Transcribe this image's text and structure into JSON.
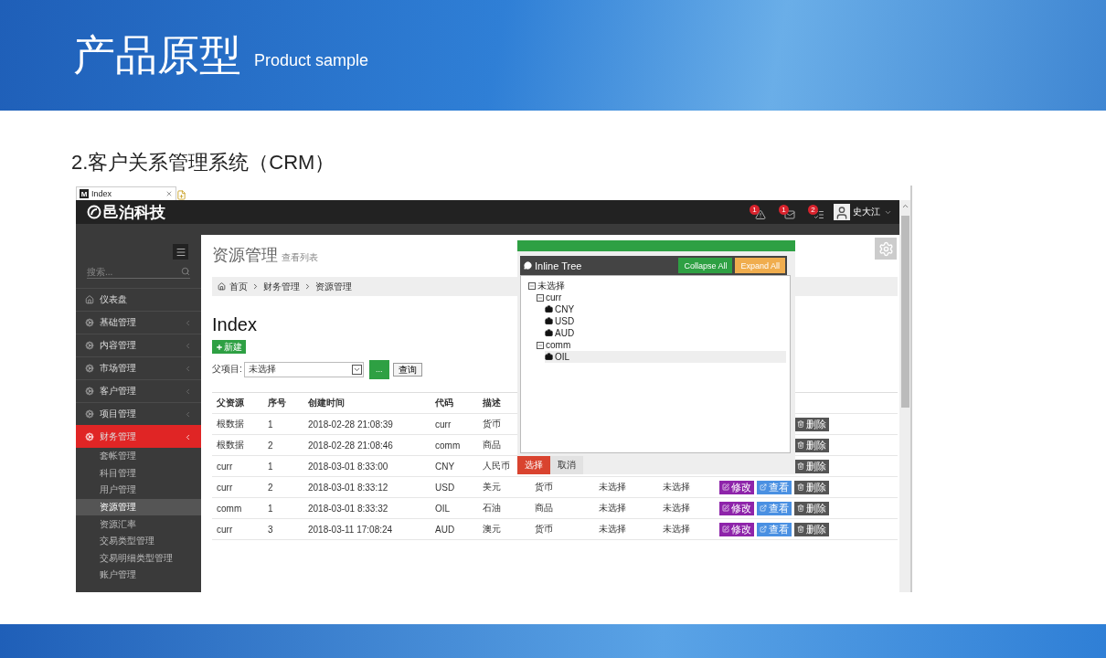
{
  "slide": {
    "title": "产品原型",
    "subtitle": "Product sample",
    "heading": "2.客户关系管理系统（CRM）"
  },
  "browser": {
    "tab": {
      "favicon": "M",
      "title": "Index"
    }
  },
  "topbar": {
    "logo": "邑泊科技",
    "alerts": [
      {
        "kind": "warning",
        "count": "1"
      },
      {
        "kind": "mail",
        "count": "1"
      },
      {
        "kind": "tasks",
        "count": "2"
      }
    ],
    "user": "史大江"
  },
  "sidebar": {
    "search": {
      "placeholder": "搜索..."
    },
    "items": [
      {
        "label": "仪表盘",
        "kind": "home",
        "selected": false
      },
      {
        "label": "基础管理",
        "kind": "group",
        "selected": false
      },
      {
        "label": "内容管理",
        "kind": "group",
        "selected": false
      },
      {
        "label": "市场管理",
        "kind": "group",
        "selected": false
      },
      {
        "label": "客户管理",
        "kind": "group",
        "selected": false
      },
      {
        "label": "项目管理",
        "kind": "group",
        "selected": false
      },
      {
        "label": "财务管理",
        "kind": "group",
        "selected": true,
        "children": [
          {
            "label": "套帐管理",
            "selected": false
          },
          {
            "label": "科目管理",
            "selected": false
          },
          {
            "label": "用户管理",
            "selected": false
          },
          {
            "label": "资源管理",
            "selected": true
          },
          {
            "label": "资源汇率",
            "selected": false
          },
          {
            "label": "交易类型管理",
            "selected": false
          },
          {
            "label": "交易明细类型管理",
            "selected": false
          },
          {
            "label": "账户管理",
            "selected": false
          }
        ]
      }
    ]
  },
  "page": {
    "title": "资源管理",
    "subtitle": "查看列表",
    "breadcrumb": [
      "首页",
      "财务管理",
      "资源管理"
    ],
    "heading": "Index",
    "new_button": "新建",
    "filter": {
      "label": "父项目:",
      "value": "未选择",
      "pick_button": "...",
      "query_button": "查询"
    }
  },
  "table": {
    "columns": [
      "父资源",
      "序号",
      "创建时间",
      "代码",
      "描述"
    ],
    "rows": [
      {
        "cells": [
          "根数据",
          "1",
          "2018-02-28 21:08:39",
          "curr",
          "货币"
        ],
        "actions": [
          {
            "kind": "delete",
            "label": "删除"
          }
        ]
      },
      {
        "cells": [
          "根数据",
          "2",
          "2018-02-28 21:08:46",
          "comm",
          "商品"
        ],
        "actions": [
          {
            "kind": "delete",
            "label": "删除"
          }
        ]
      },
      {
        "cells": [
          "curr",
          "1",
          "2018-03-01 8:33:00",
          "CNY",
          "人民币"
        ],
        "actions": [
          {
            "kind": "delete",
            "label": "删除"
          }
        ]
      },
      {
        "cells": [
          "curr",
          "2",
          "2018-03-01 8:33:12",
          "USD",
          "美元",
          "货币",
          "未选择",
          "未选择"
        ],
        "actions": [
          {
            "kind": "edit",
            "label": "修改"
          },
          {
            "kind": "view",
            "label": "查看"
          },
          {
            "kind": "delete",
            "label": "删除"
          }
        ]
      },
      {
        "cells": [
          "comm",
          "1",
          "2018-03-01 8:33:32",
          "OIL",
          "石油",
          "商品",
          "未选择",
          "未选择"
        ],
        "actions": [
          {
            "kind": "edit",
            "label": "修改"
          },
          {
            "kind": "view",
            "label": "查看"
          },
          {
            "kind": "delete",
            "label": "删除"
          }
        ]
      },
      {
        "cells": [
          "curr",
          "3",
          "2018-03-11 17:08:24",
          "AUD",
          "澳元",
          "货币",
          "未选择",
          "未选择"
        ],
        "actions": [
          {
            "kind": "edit",
            "label": "修改"
          },
          {
            "kind": "view",
            "label": "查看"
          },
          {
            "kind": "delete",
            "label": "删除"
          }
        ]
      }
    ]
  },
  "dialog": {
    "title": "Inline Tree",
    "collapse_button": "Collapse All",
    "expand_button": "Expand All",
    "tree": [
      {
        "label": "未选择",
        "expanded": true,
        "selected": false,
        "children": [
          {
            "label": "curr",
            "expanded": true,
            "selected": false,
            "children": [
              {
                "label": "CNY",
                "selected": false
              },
              {
                "label": "USD",
                "selected": false
              },
              {
                "label": "AUD",
                "selected": false
              }
            ]
          },
          {
            "label": "comm",
            "expanded": true,
            "selected": false,
            "children": [
              {
                "label": "OIL",
                "selected": true
              }
            ]
          }
        ]
      }
    ],
    "confirm_button": "选择",
    "cancel_button": "取消"
  }
}
